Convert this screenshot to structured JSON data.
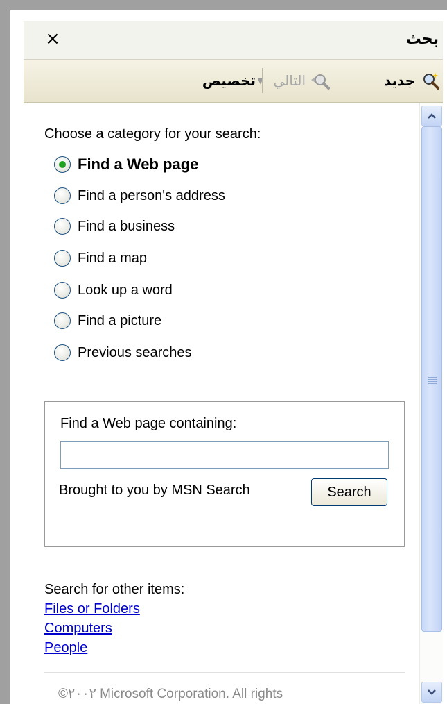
{
  "window": {
    "title": "بحث",
    "close_glyph": "×"
  },
  "toolbar": {
    "new_label": "جديد",
    "new_icon": "magnifier-sparkle-icon",
    "next_label": "التالي",
    "next_icon": "magnifier-arrow-icon",
    "customize_label": "تخصيص"
  },
  "search": {
    "prompt": "Choose a category for your search:",
    "options": [
      {
        "label": "Find a Web page",
        "selected": true
      },
      {
        "label": "Find a person's address",
        "selected": false
      },
      {
        "label": "Find a business",
        "selected": false
      },
      {
        "label": "Find a map",
        "selected": false
      },
      {
        "label": "Look up a word",
        "selected": false
      },
      {
        "label": "Find a picture",
        "selected": false
      },
      {
        "label": "Previous searches",
        "selected": false
      }
    ],
    "group_title": "Find a Web page containing:",
    "query_value": "",
    "provider_text": "Brought to you by MSN Search",
    "button_label": "Search"
  },
  "other": {
    "label": "Search for other items:",
    "links": [
      "Files or Folders",
      "Computers",
      "People"
    ]
  },
  "footer": {
    "copyright": "©٢٠٠٢ Microsoft Corporation. All rights"
  },
  "colors": {
    "toolbar_bg": "#ece8d4",
    "link": "#0000cc",
    "scrollbar": "#c6d7f7",
    "radio_dot": "#21a121"
  }
}
